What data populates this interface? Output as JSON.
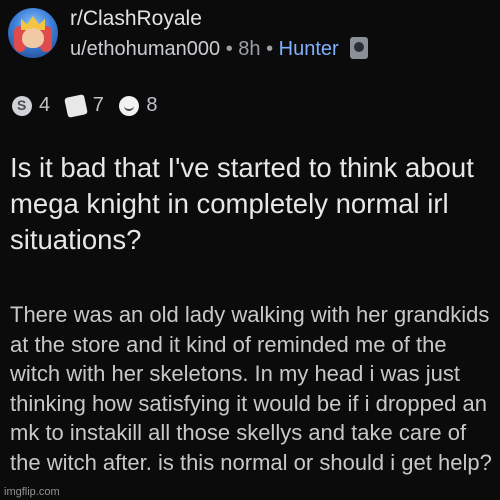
{
  "post": {
    "subreddit": "r/ClashRoyale",
    "author": "u/ethohuman000",
    "separator1": "•",
    "age": "8h",
    "separator2": "•",
    "flair": "Hunter",
    "awards": [
      {
        "icon": "silver-award-icon",
        "count": "4"
      },
      {
        "icon": "helpful-award-icon",
        "count": "7"
      },
      {
        "icon": "wholesome-award-icon",
        "count": "8"
      }
    ],
    "title": "Is it bad that I've started to think about mega knight in completely normal irl situations?",
    "body": "There was an old lady walking with her grandkids at the store and it kind of reminded me of the witch with her skeletons. In my head i was just thinking how satisfying it would be if i dropped an mk to instakill all those skellys and take care of the witch after. is this normal or should i get help?"
  },
  "watermark": "imgflip.com"
}
